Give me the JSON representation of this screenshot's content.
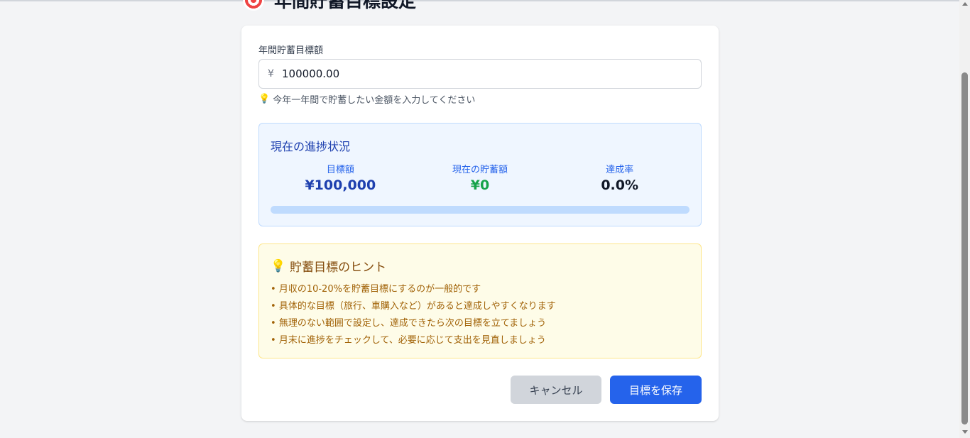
{
  "header": {
    "title": "年間貯蓄目標設定",
    "icon": "target-icon"
  },
  "form": {
    "label": "年間貯蓄目標額",
    "currency_symbol": "¥",
    "amount_value": "100000.00",
    "hint": "今年一年間で貯蓄したい金額を入力してください",
    "hint_icon": "lightbulb-icon"
  },
  "progress": {
    "title": "現在の進捗状況",
    "target_label": "目標額",
    "target_value": "¥100,000",
    "current_label": "現在の貯蓄額",
    "current_value": "¥0",
    "rate_label": "達成率",
    "rate_value": "0.0%",
    "fill_fraction": 0.0
  },
  "tips": {
    "icon": "lightbulb-icon",
    "title": "貯蓄目標のヒント",
    "items": [
      "月収の10-20%を貯蓄目標にするのが一般的です",
      "具体的な目標（旅行、車購入など）があると達成しやすくなります",
      "無理のない範囲で設定し、達成できたら次の目標を立てましょう",
      "月末に進捗をチェックして、必要に応じて支出を見直しましょう"
    ]
  },
  "actions": {
    "cancel_label": "キャンセル",
    "save_label": "目標を保存"
  },
  "colors": {
    "primary": "#2563eb",
    "success": "#16a34a",
    "tips_text": "#a16207",
    "panel_bg": "#eff6ff"
  }
}
